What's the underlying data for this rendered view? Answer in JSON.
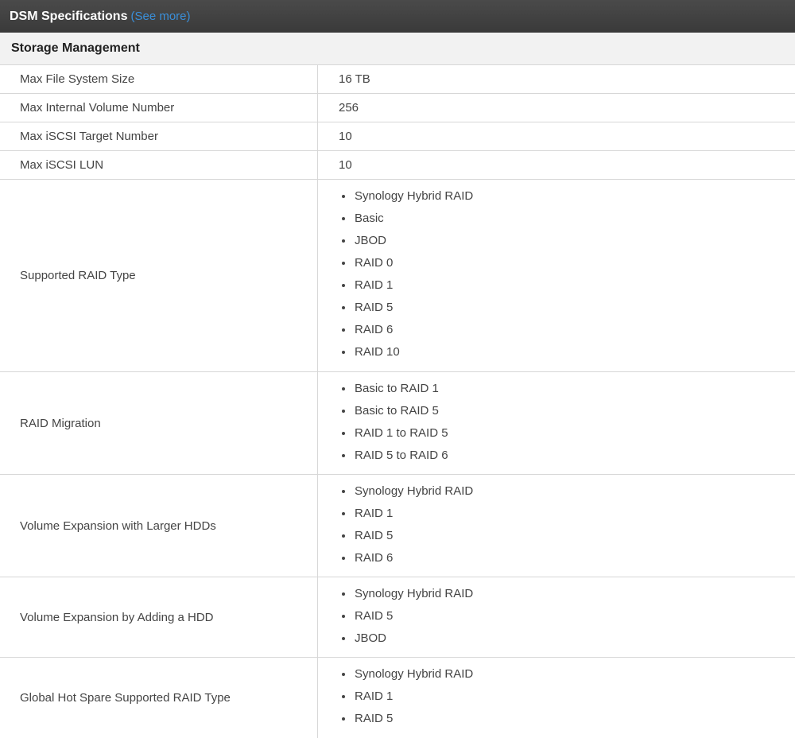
{
  "header": {
    "title": "DSM Specifications",
    "link": "(See more)"
  },
  "section": {
    "title": "Storage Management"
  },
  "rows": [
    {
      "label": "Max File System Size",
      "value": "16 TB"
    },
    {
      "label": "Max Internal Volume Number",
      "value": "256"
    },
    {
      "label": "Max iSCSI Target Number",
      "value": "10"
    },
    {
      "label": "Max iSCSI LUN",
      "value": "10"
    },
    {
      "label": "Supported RAID Type",
      "items": [
        "Synology Hybrid RAID",
        "Basic",
        "JBOD",
        "RAID 0",
        "RAID 1",
        "RAID 5",
        "RAID 6",
        "RAID 10"
      ]
    },
    {
      "label": "RAID Migration",
      "items": [
        "Basic to RAID 1",
        "Basic to RAID 5",
        "RAID 1 to RAID 5",
        "RAID 5 to RAID 6"
      ]
    },
    {
      "label": "Volume Expansion with Larger HDDs",
      "items": [
        "Synology Hybrid RAID",
        "RAID 1",
        "RAID 5",
        "RAID 6"
      ]
    },
    {
      "label": "Volume Expansion by Adding a HDD",
      "items": [
        "Synology Hybrid RAID",
        "RAID 5",
        "JBOD"
      ]
    },
    {
      "label": "Global Hot Spare Supported RAID Type",
      "items": [
        "Synology Hybrid RAID",
        "RAID 1",
        "RAID 5"
      ]
    }
  ]
}
